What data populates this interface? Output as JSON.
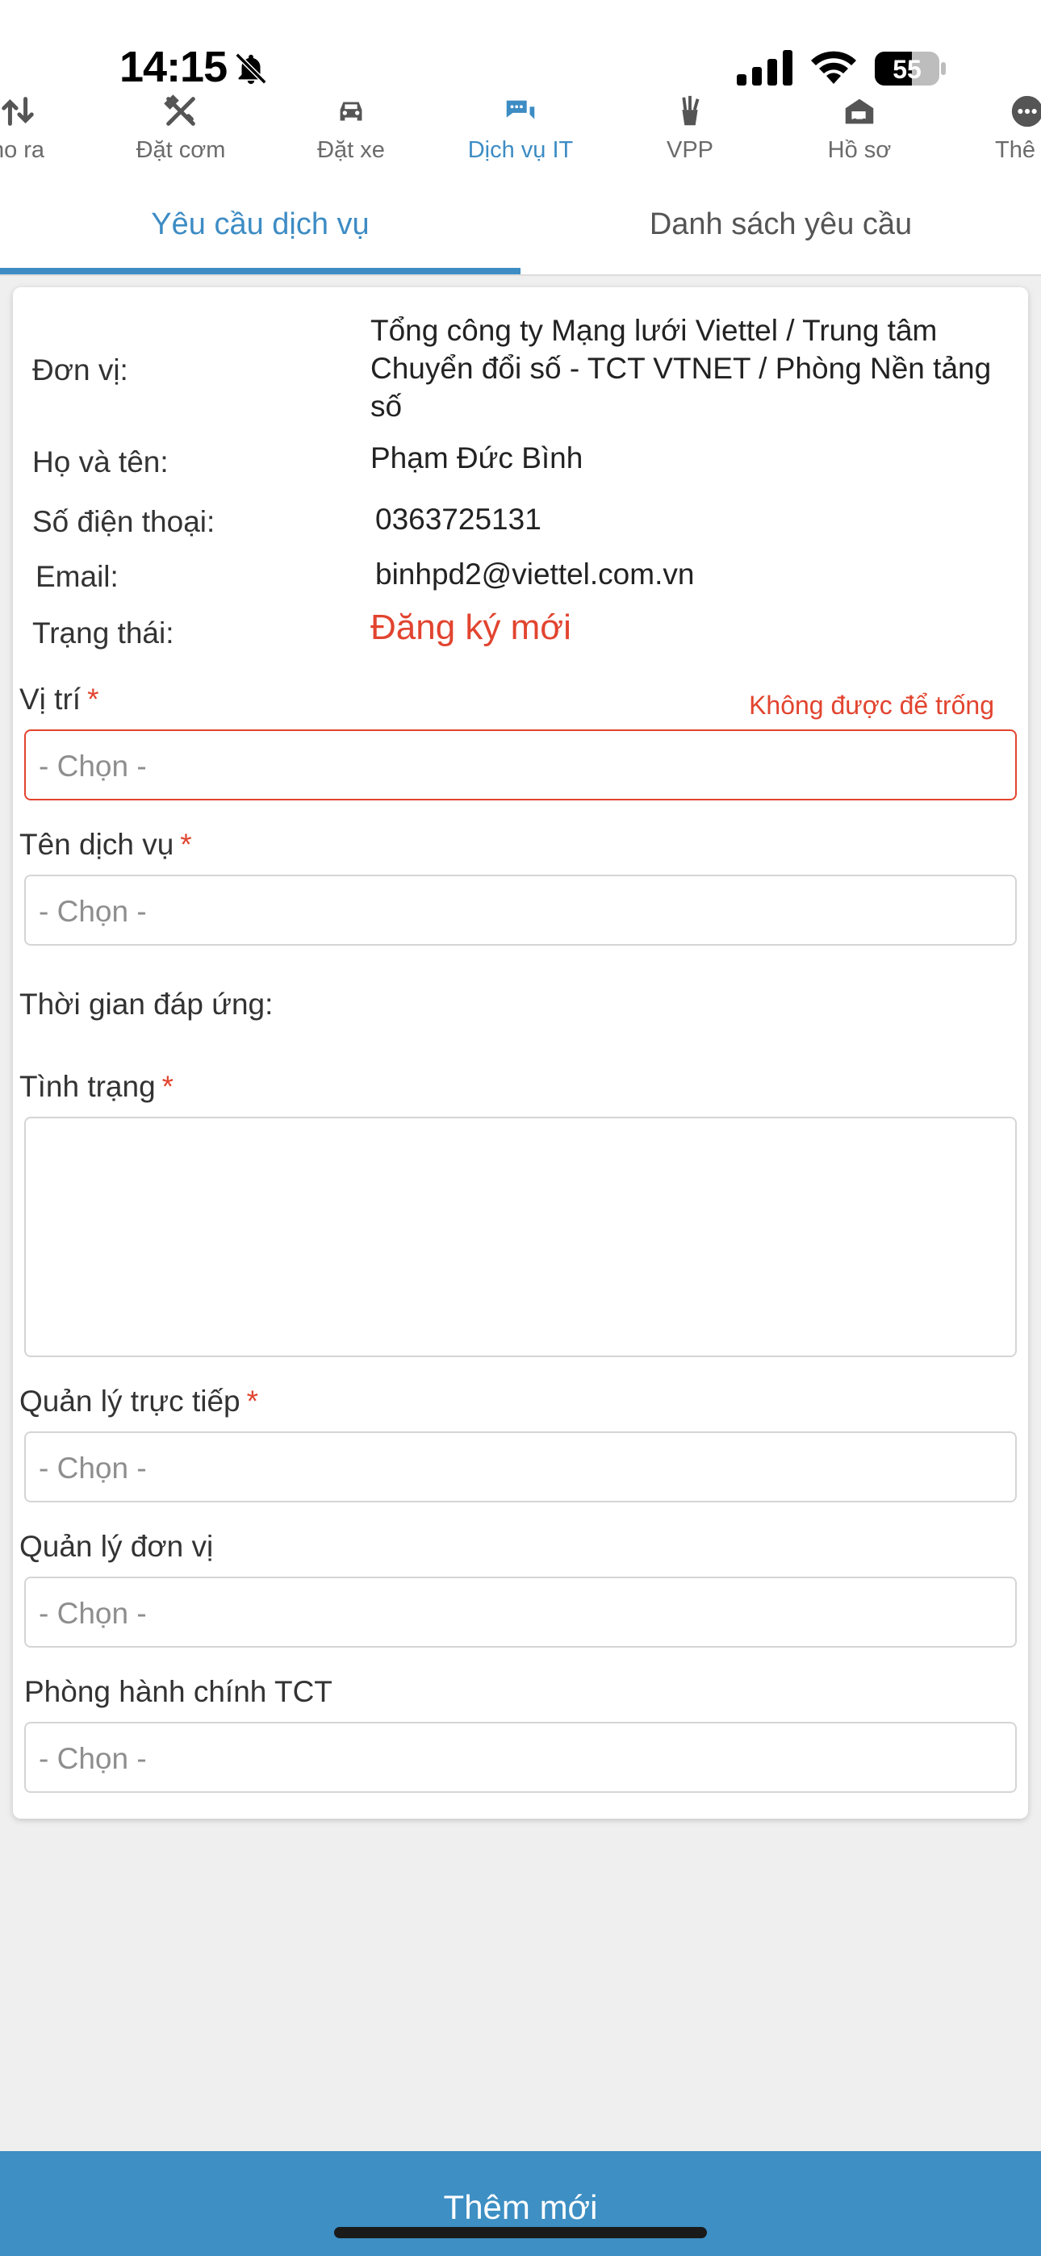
{
  "status_bar": {
    "time": "14:15",
    "battery_level": "55"
  },
  "top_nav": {
    "items": [
      {
        "label": "ho ra",
        "icon": "swap-vertical-icon"
      },
      {
        "label": "Đặt cơm",
        "icon": "fork-knife-icon"
      },
      {
        "label": "Đặt xe",
        "icon": "car-icon"
      },
      {
        "label": "Dịch vụ IT",
        "icon": "chat-bubbles-icon",
        "active": true
      },
      {
        "label": "VPP",
        "icon": "pencil-cup-icon"
      },
      {
        "label": "Hồ sơ",
        "icon": "delivery-truck-icon"
      },
      {
        "label": "Thê",
        "icon": "more-icon"
      }
    ]
  },
  "tabs": {
    "request": "Yêu cầu dịch vụ",
    "list": "Danh sách yêu cầu",
    "active": "request"
  },
  "info": {
    "unit_label": "Đơn vị:",
    "unit_value": "Tổng công ty Mạng lưới Viettel / Trung tâm Chuyển đổi số - TCT VTNET / Phòng Nền tảng số",
    "name_label": "Họ và tên:",
    "name_value": "Phạm Đức Bình",
    "phone_label": "Số điện thoại:",
    "phone_value": "0363725131",
    "email_label": "Email:",
    "email_value": "binhpd2@viettel.com.vn",
    "status_label": "Trạng thái:",
    "status_value": "Đăng ký mới"
  },
  "form": {
    "required_mark": "*",
    "location_label": "Vị trí",
    "location_error": "Không được để trống",
    "location_placeholder": "- Chọn -",
    "service_label": "Tên dịch vụ",
    "service_placeholder": "- Chọn -",
    "response_time_label": "Thời gian đáp ứng:",
    "condition_label": "Tình trạng",
    "condition_value": "",
    "direct_manager_label": "Quản lý trực tiếp",
    "direct_manager_placeholder": "- Chọn -",
    "unit_manager_label": "Quản lý đơn vị",
    "unit_manager_placeholder": "- Chọn -",
    "admin_dept_label": "Phòng hành chính TCT",
    "admin_dept_placeholder": "- Chọn -"
  },
  "actions": {
    "add_new": "Thêm mới"
  },
  "colors": {
    "accent": "#3d8cc4",
    "error": "#e2442f",
    "button": "#3d8fc4"
  }
}
